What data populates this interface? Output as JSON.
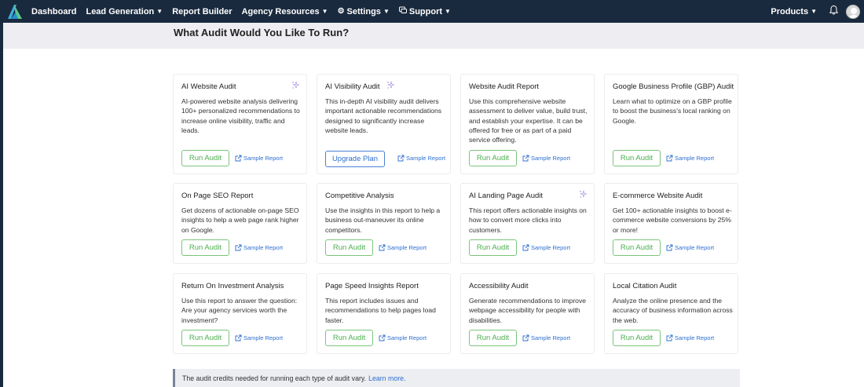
{
  "nav": {
    "items": [
      {
        "label": "Dashboard",
        "chevron": false,
        "icon": ""
      },
      {
        "label": "Lead Generation",
        "chevron": true,
        "icon": ""
      },
      {
        "label": "Report Builder",
        "chevron": false,
        "icon": ""
      },
      {
        "label": "Agency Resources",
        "chevron": true,
        "icon": ""
      },
      {
        "label": "Settings",
        "chevron": true,
        "icon": "gear-icon"
      },
      {
        "label": "Support",
        "chevron": true,
        "icon": "support-icon"
      }
    ],
    "products_label": "Products"
  },
  "page": {
    "title": "What Audit Would You Like To Run?"
  },
  "cards": [
    {
      "title": "AI Website Audit",
      "ai": true,
      "desc": "AI-powered website analysis delivering 100+ personalized recommendations to increase online visibility, traffic and leads.",
      "button": "Run Audit",
      "button_type": "run",
      "sample": "Sample Report"
    },
    {
      "title": "AI Visibility Audit",
      "ai": true,
      "desc": "This in-depth AI visibility audit delivers important actionable recommendations designed to significantly increase website leads.",
      "button": "Upgrade Plan",
      "button_type": "upgrade",
      "sample": "Sample Report"
    },
    {
      "title": "Website Audit Report",
      "ai": false,
      "desc": "Use this comprehensive website assessment to deliver value, build trust, and establish your expertise. It can be offered for free or as part of a paid service offering.",
      "button": "Run Audit",
      "button_type": "run",
      "sample": "Sample Report"
    },
    {
      "title": "Google Business Profile (GBP) Audit",
      "ai": false,
      "desc": "Learn what to optimize on a GBP profile to boost the business's local ranking on Google.",
      "button": "Run Audit",
      "button_type": "run",
      "sample": "Sample Report"
    },
    {
      "title": "On Page SEO Report",
      "ai": false,
      "desc": "Get dozens of actionable on-page SEO insights to help a web page rank higher on Google.",
      "button": "Run Audit",
      "button_type": "run",
      "sample": "Sample Report"
    },
    {
      "title": "Competitive Analysis",
      "ai": false,
      "desc": "Use the insights in this report to help a business out-maneuver its online competitors.",
      "button": "Run Audit",
      "button_type": "run",
      "sample": "Sample Report"
    },
    {
      "title": "AI Landing Page Audit",
      "ai": true,
      "desc": "This report offers actionable insights on how to convert more clicks into customers.",
      "button": "Run Audit",
      "button_type": "run",
      "sample": "Sample Report"
    },
    {
      "title": "E-commerce Website Audit",
      "ai": false,
      "desc": "Get 100+ actionable insights to boost e-commerce website conversions by 25% or more!",
      "button": "Run Audit",
      "button_type": "run",
      "sample": "Sample Report"
    },
    {
      "title": "Return On Investment Analysis",
      "ai": false,
      "desc": "Use this report to answer the question: Are your agency services worth the investment?",
      "button": "Run Audit",
      "button_type": "run",
      "sample": "Sample Report"
    },
    {
      "title": "Page Speed Insights Report",
      "ai": false,
      "desc": "This report includes issues and recommendations to help pages load faster.",
      "button": "Run Audit",
      "button_type": "run",
      "sample": "Sample Report"
    },
    {
      "title": "Accessibility Audit",
      "ai": false,
      "desc": "Generate recommendations to improve webpage accessibility for people with disabilities.",
      "button": "Run Audit",
      "button_type": "run",
      "sample": "Sample Report"
    },
    {
      "title": "Local Citation Audit",
      "ai": false,
      "desc": "Analyze the online presence and the accuracy of business information across the web.",
      "button": "Run Audit",
      "button_type": "run",
      "sample": "Sample Report"
    }
  ],
  "info": {
    "text": "The audit credits needed for running each type of audit vary.",
    "link": "Learn more."
  },
  "colors": {
    "nav_bg": "#1a2a3e",
    "run_green": "#4caf50",
    "link_blue": "#2e6fd1",
    "ai_purple": "#8a6ad6"
  }
}
